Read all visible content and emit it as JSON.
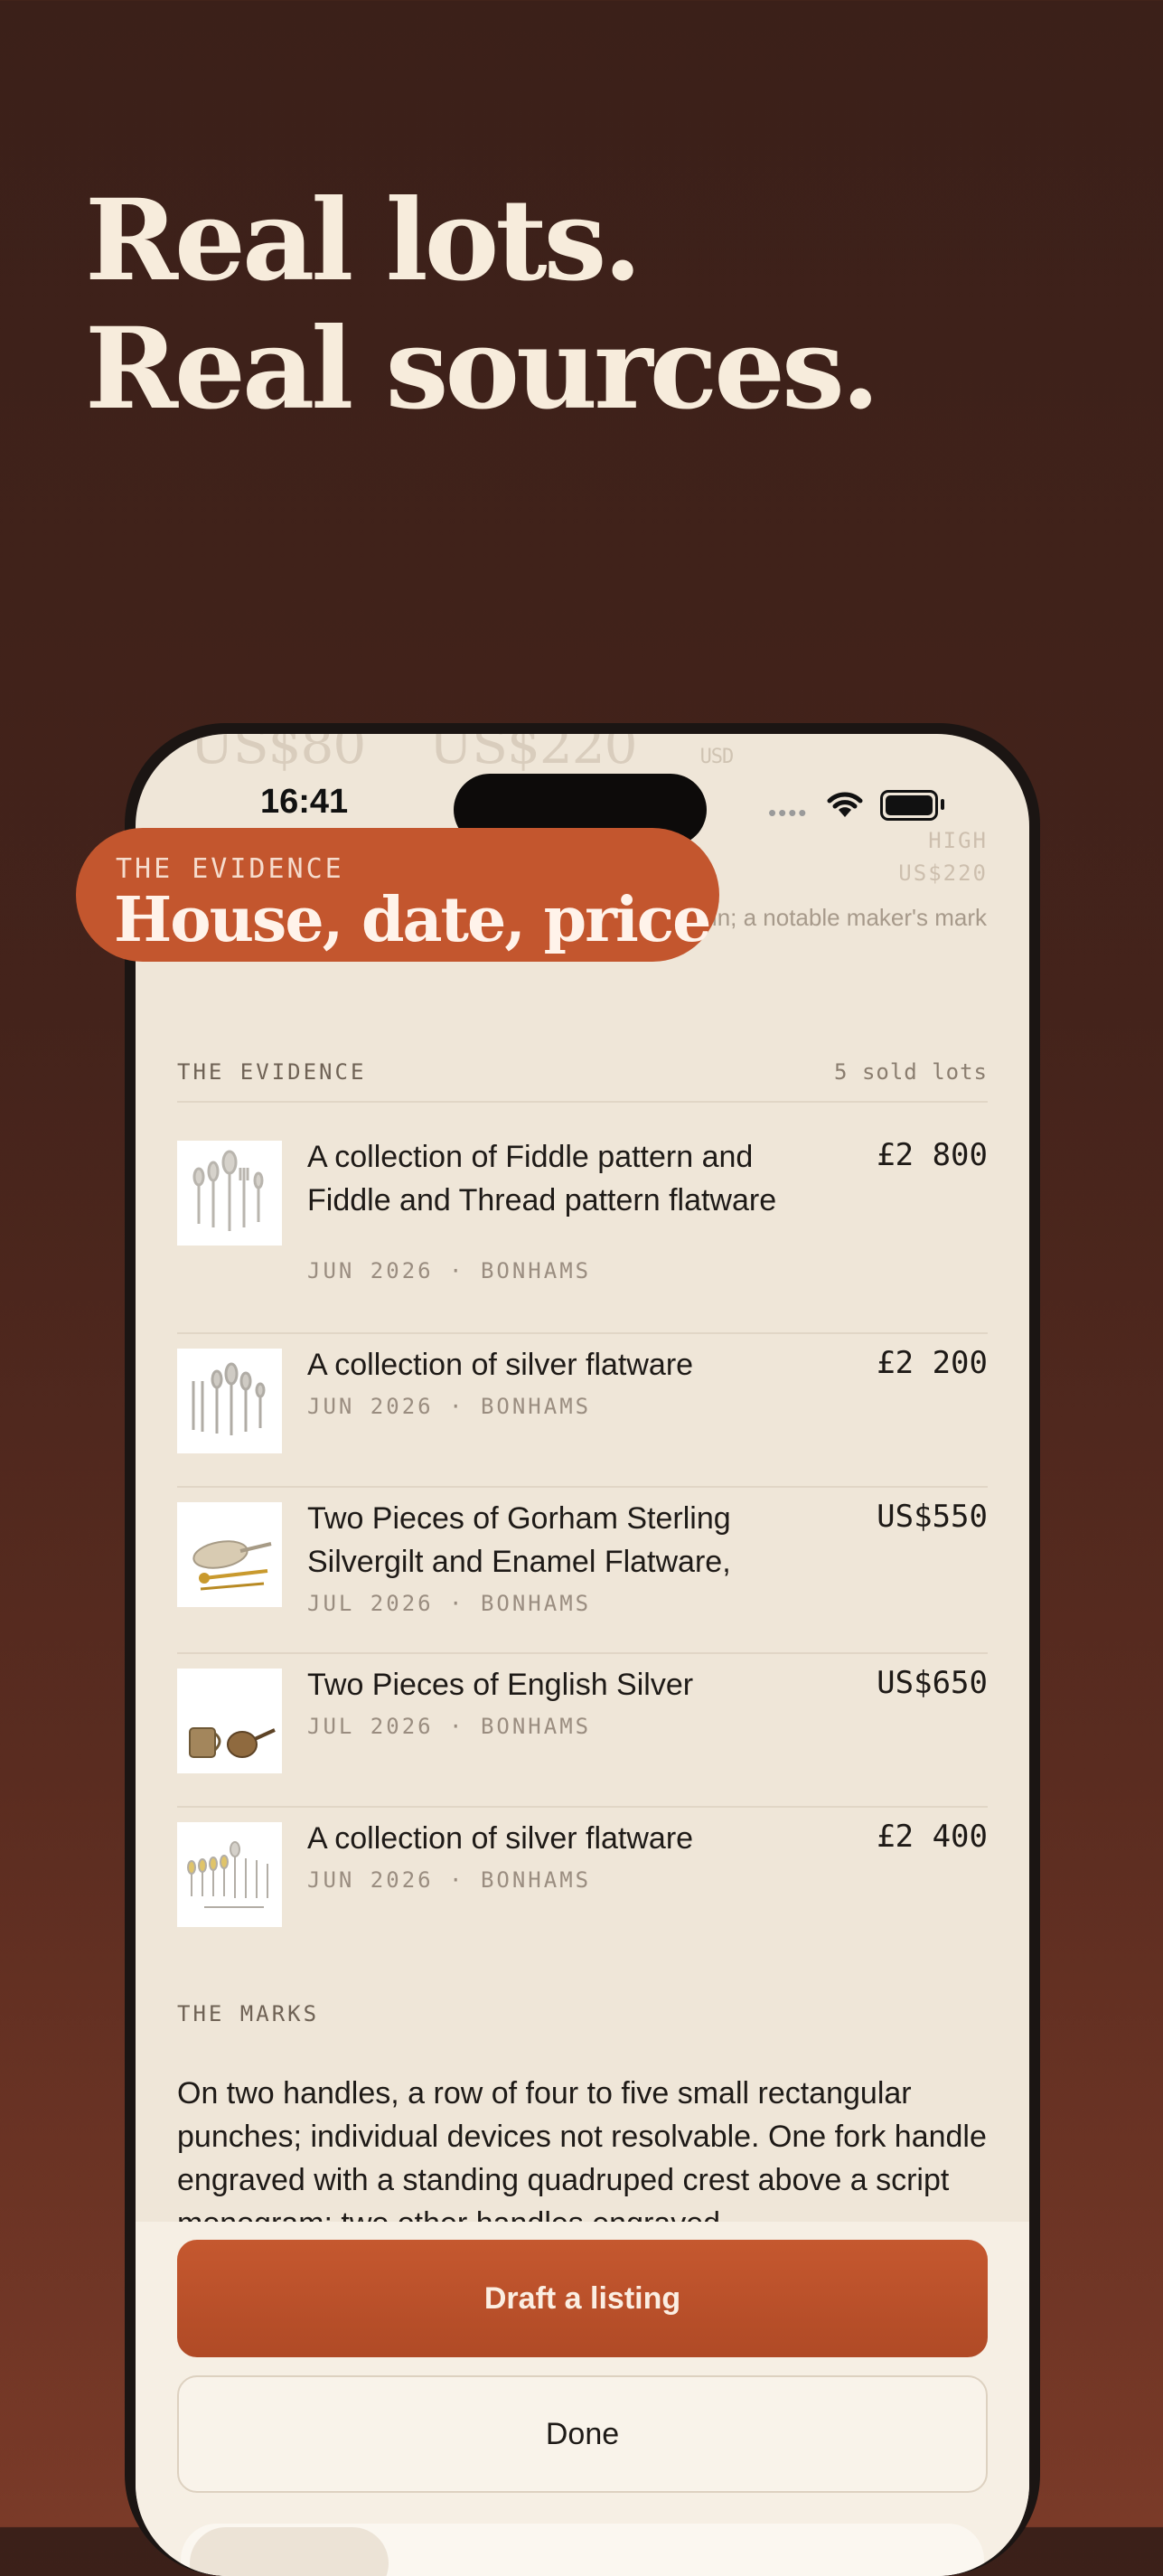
{
  "headline": {
    "line1": "Real lots.",
    "line2": "Real sources."
  },
  "badge": {
    "kicker": "THE EVIDENCE",
    "title": "House, date, price"
  },
  "statusbar": {
    "time": "16:41"
  },
  "estimate": {
    "ghost_low": "US$80",
    "ghost_high": "US$220",
    "ghost_unit": "USD",
    "high_label": "HIGH",
    "high_value": "US$220",
    "note": "…ddle pattern flatware …ght plus a small margin; a notable maker's mark would raise this."
  },
  "evidence": {
    "heading": "THE EVIDENCE",
    "count": "5 sold lots",
    "lots": [
      {
        "title": "A collection of Fiddle pattern and Fiddle and Thread pattern flatware",
        "meta": "JUN 2026 · BONHAMS",
        "price": "£2 800"
      },
      {
        "title": "A collection of silver flatware",
        "meta": "JUN 2026 · BONHAMS",
        "price": "£2 200"
      },
      {
        "title": "Two Pieces of Gorham Sterling Silvergilt and Enamel Flatware,",
        "meta": "JUL 2026 · BONHAMS",
        "price": "US$550"
      },
      {
        "title": "Two Pieces of English Silver",
        "meta": "JUL 2026 · BONHAMS",
        "price": "US$650"
      },
      {
        "title": "A collection of silver flatware",
        "meta": "JUN 2026 · BONHAMS",
        "price": "£2 400"
      }
    ]
  },
  "marks": {
    "heading": "THE MARKS",
    "text": "On two handles, a row of four to five small rectangular punches; individual devices not resolvable. One fork handle engraved with a standing quadruped crest above a script monogram; two other handles engraved"
  },
  "actions": {
    "primary": "Draft a listing",
    "secondary": "Done"
  },
  "colors": {
    "accent": "#c3562e",
    "background_top": "#3b2019",
    "screen": "#efe6d8"
  }
}
